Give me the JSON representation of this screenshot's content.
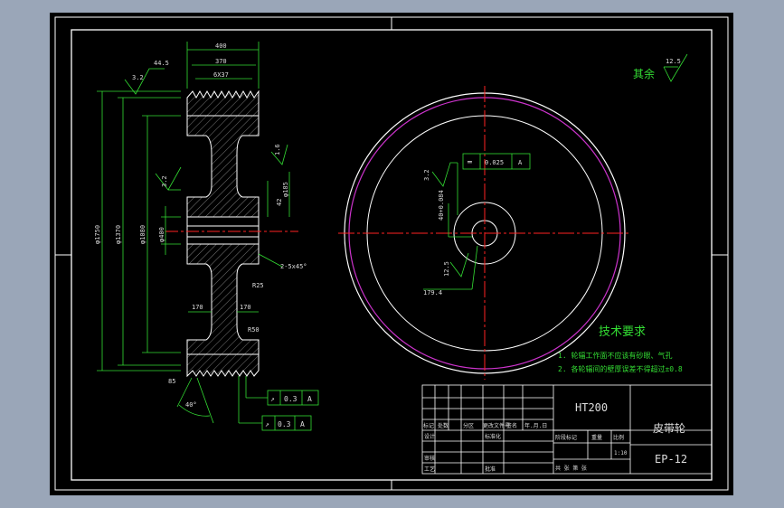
{
  "dimensions": {
    "top_width_total": "400",
    "top_width_mid": "370",
    "top_width_inner": "6X37",
    "top_offset": "44.5",
    "roughness_top": "3.2",
    "dia_outer": "φ1750",
    "dia_rim": "φ1370",
    "dia_inner": "φ1080",
    "dia_hub": "φ400",
    "roughness_side": "3.2",
    "bore_right": "φ185",
    "rough_small": "1.6",
    "chamfer_right": "2-5x45°",
    "keyway": "42",
    "web_radius": "R25",
    "web_thick_left": "170",
    "web_thick_right": "170",
    "rib": "R50",
    "bottom_left": "85",
    "groove_angle": "40°",
    "fcf1_symbol": "↗",
    "fcf1_value": "0.3",
    "fcf1_datum": "A",
    "fcf2_symbol": "↗",
    "fcf2_value": "0.3",
    "fcf2_datum": "A"
  },
  "front_view": {
    "roughness": "3.2",
    "fcf_symbol": "═",
    "fcf_value": "0.025",
    "fcf_datum": "A",
    "keyway_label": "40+0.084",
    "rough_key": "12.5",
    "key_dim": "179.4"
  },
  "surface_finish": {
    "label": "其余",
    "value": "12.5"
  },
  "tech": {
    "title": "技术要求",
    "line1": "1. 轮辐工作面不应该有砂眼、气孔",
    "line2": "2. 各轮辐间的壁厚误差不得超过±0.8"
  },
  "title_block": {
    "material": "HT200",
    "part_name": "皮带轮",
    "drawing_no": "EP-12",
    "scale": "1:10",
    "row_labels": [
      "标记",
      "处数",
      "分区",
      "更改文件号",
      "签名",
      "年.月.日"
    ],
    "designer": "设计",
    "standardize": "标准化",
    "review": "审核",
    "process": "工艺",
    "approve": "批准",
    "stage_label": "阶段标记",
    "weight_label": "重量",
    "scale_label": "比例",
    "sheet_label": "共    张    第    张"
  }
}
